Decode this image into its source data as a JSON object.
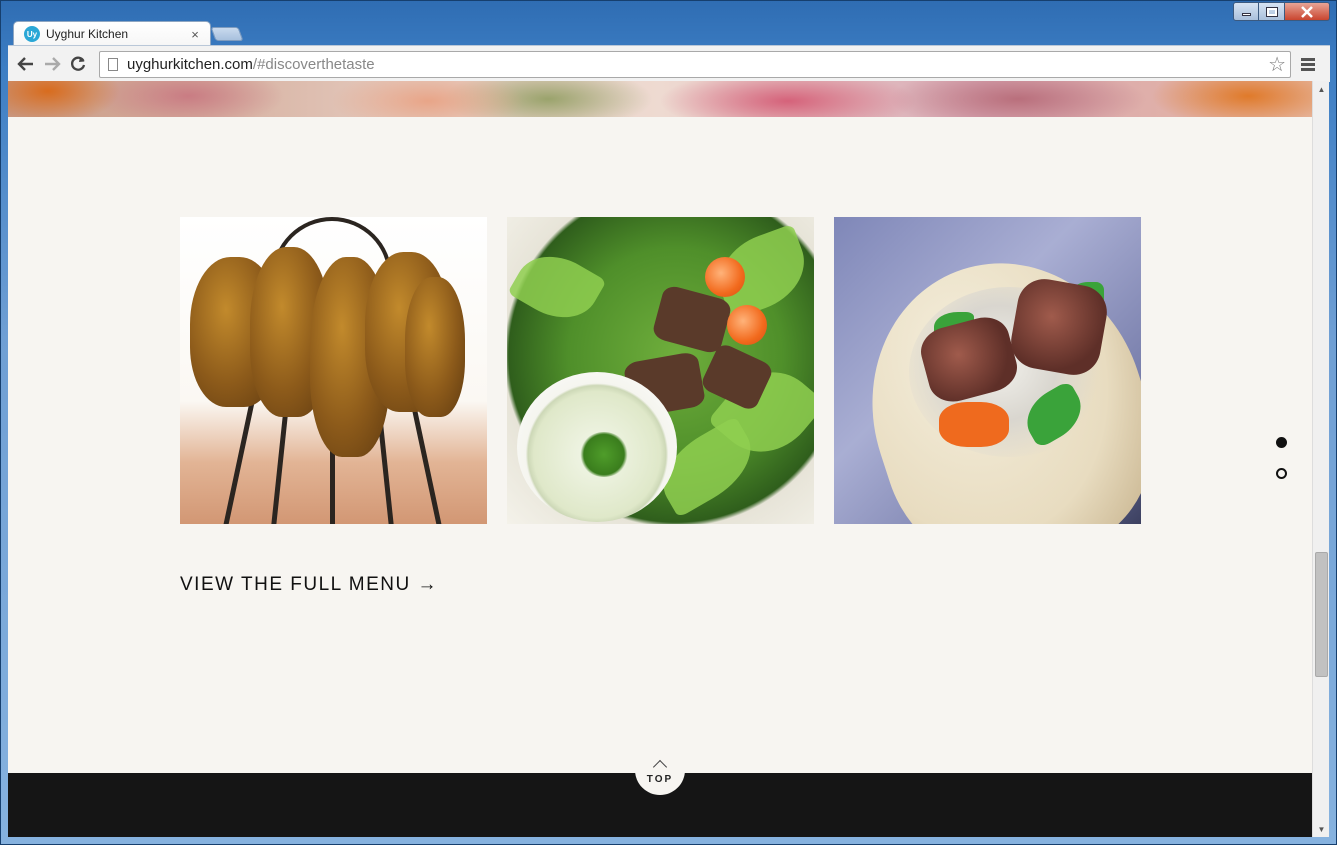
{
  "browser": {
    "tab": {
      "favicon_text": "Uy",
      "title": "Uyghur Kitchen",
      "close_glyph": "×"
    },
    "address": {
      "host": "uyghurkitchen.com",
      "path": "/#discoverthetaste"
    }
  },
  "page": {
    "gallery": [
      {
        "alt": "kebab skewers on rack"
      },
      {
        "alt": "salad with beef and yogurt dip"
      },
      {
        "alt": "wrap with meat and vegetables"
      }
    ],
    "menu_link": "VIEW THE FULL MENU →",
    "section_dots": [
      {
        "active": true
      },
      {
        "active": false
      }
    ],
    "top_button": {
      "label": "TOP"
    }
  },
  "colors": {
    "page_background": "#f7f5f1",
    "footer": "#151515",
    "link_text": "#111111"
  }
}
